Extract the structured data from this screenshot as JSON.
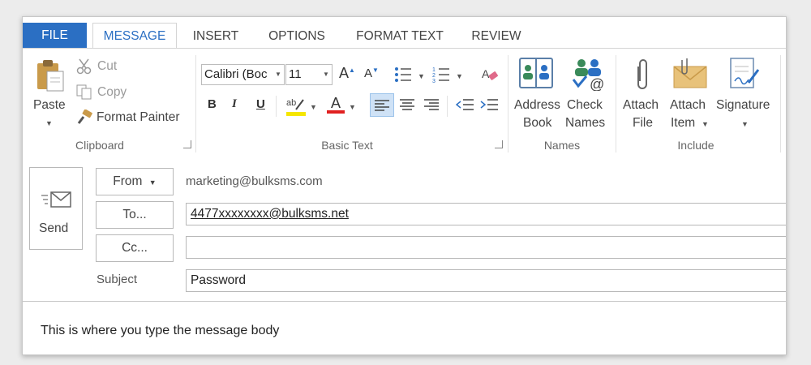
{
  "tabs": [
    "FILE",
    "MESSAGE",
    "INSERT",
    "OPTIONS",
    "FORMAT TEXT",
    "REVIEW"
  ],
  "clipboard": {
    "paste": "Paste",
    "cut": "Cut",
    "copy": "Copy",
    "format_painter": "Format Painter",
    "group_label": "Clipboard"
  },
  "basic_text": {
    "font_name": "Calibri (Boc",
    "font_size": "11",
    "bold": "B",
    "italic": "I",
    "underline": "U",
    "font_color_letter": "A",
    "group_label": "Basic Text",
    "colors": {
      "highlight": "#f5e600",
      "font": "#e02020",
      "accent": "#2b6fc3"
    }
  },
  "names": {
    "address_book_line1": "Address",
    "address_book_line2": "Book",
    "check_names_line1": "Check",
    "check_names_line2": "Names",
    "group_label": "Names"
  },
  "include": {
    "attach_file_line1": "Attach",
    "attach_file_line2": "File",
    "attach_item_line1": "Attach",
    "attach_item_line2": "Item",
    "signature": "Signature",
    "group_label": "Include"
  },
  "compose": {
    "send": "Send",
    "from_button": "From",
    "from_value": "marketing@bulksms.com",
    "to_button": "To...",
    "to_value": "4477xxxxxxxx@bulksms.net",
    "cc_button": "Cc...",
    "cc_value": "",
    "subject_label": "Subject",
    "subject_value": "Password",
    "body": "This is where you type the message body"
  }
}
